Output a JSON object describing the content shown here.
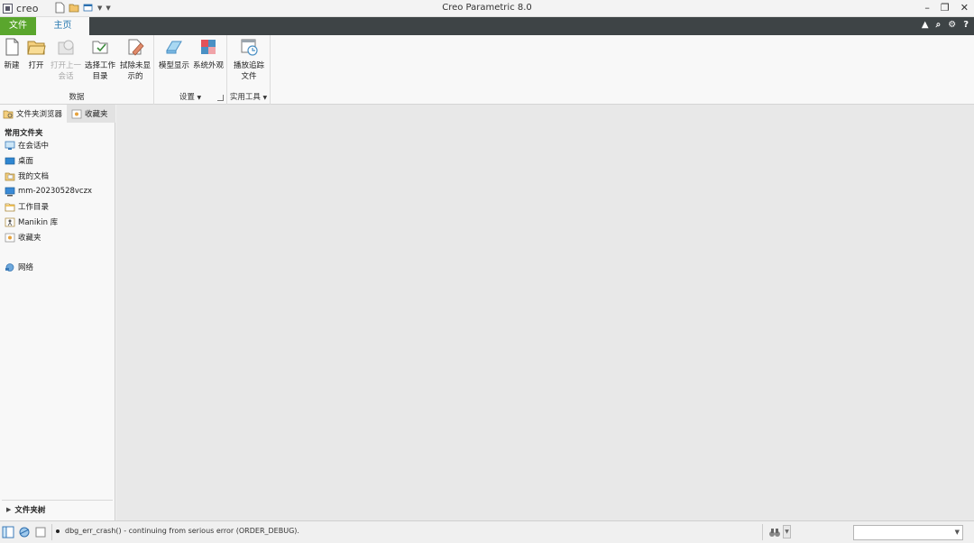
{
  "app": {
    "logo_text": "creo",
    "window_title": "Creo Parametric 8.0"
  },
  "window_controls": {
    "minimize": "–",
    "maximize": "❐",
    "close": "✕"
  },
  "tabs": {
    "file": "文件",
    "home": "主页"
  },
  "help_icons": [
    "▲",
    "⌕",
    "⚙",
    "?"
  ],
  "ribbon": {
    "groups": [
      {
        "label": "数据",
        "buttons": [
          {
            "label": "新建",
            "icon": "new-file-icon"
          },
          {
            "label": "打开",
            "icon": "open-folder-icon"
          },
          {
            "label": "打开上一会话",
            "icon": "open-last-session-icon",
            "disabled": true
          },
          {
            "label": "选择工作目录",
            "icon": "select-working-dir-icon"
          },
          {
            "label": "拭除未显示的",
            "icon": "erase-not-displayed-icon"
          }
        ]
      },
      {
        "label": "设置",
        "buttons": [
          {
            "label": "模型显示",
            "icon": "model-display-icon"
          },
          {
            "label": "系统外观",
            "icon": "system-appearance-icon"
          }
        ]
      },
      {
        "label": "实用工具",
        "buttons": [
          {
            "label": "播放追踪文件",
            "icon": "play-trail-file-icon"
          }
        ]
      }
    ]
  },
  "browser": {
    "tabs": [
      {
        "label": "文件夹浏览器",
        "icon": "folder-browser-icon"
      },
      {
        "label": "收藏夹",
        "icon": "favorites-icon"
      }
    ],
    "common_folders_title": "常用文件夹",
    "folders": [
      {
        "label": "在会话中",
        "icon": "in-session-icon"
      },
      {
        "label": "桌面",
        "icon": "desktop-icon"
      },
      {
        "label": "我的文档",
        "icon": "my-documents-icon"
      },
      {
        "label": "mm-20230528vczx",
        "icon": "computer-icon"
      },
      {
        "label": "工作目录",
        "icon": "working-directory-icon"
      },
      {
        "label": "Manikin 库",
        "icon": "manikin-library-icon"
      },
      {
        "label": "收藏夹",
        "icon": "favorites-icon"
      }
    ],
    "network": {
      "label": "网络",
      "icon": "network-icon"
    },
    "folder_tree_title": "文件夹树"
  },
  "status": {
    "message": "dbg_err_crash() - continuing from serious error (ORDER_DEBUG)."
  },
  "colors": {
    "file_tab": "#5aa62d",
    "tab_bar": "#3e4446",
    "home_tab_text": "#2a7ab0",
    "graphics_area": "#e8e8e8"
  }
}
